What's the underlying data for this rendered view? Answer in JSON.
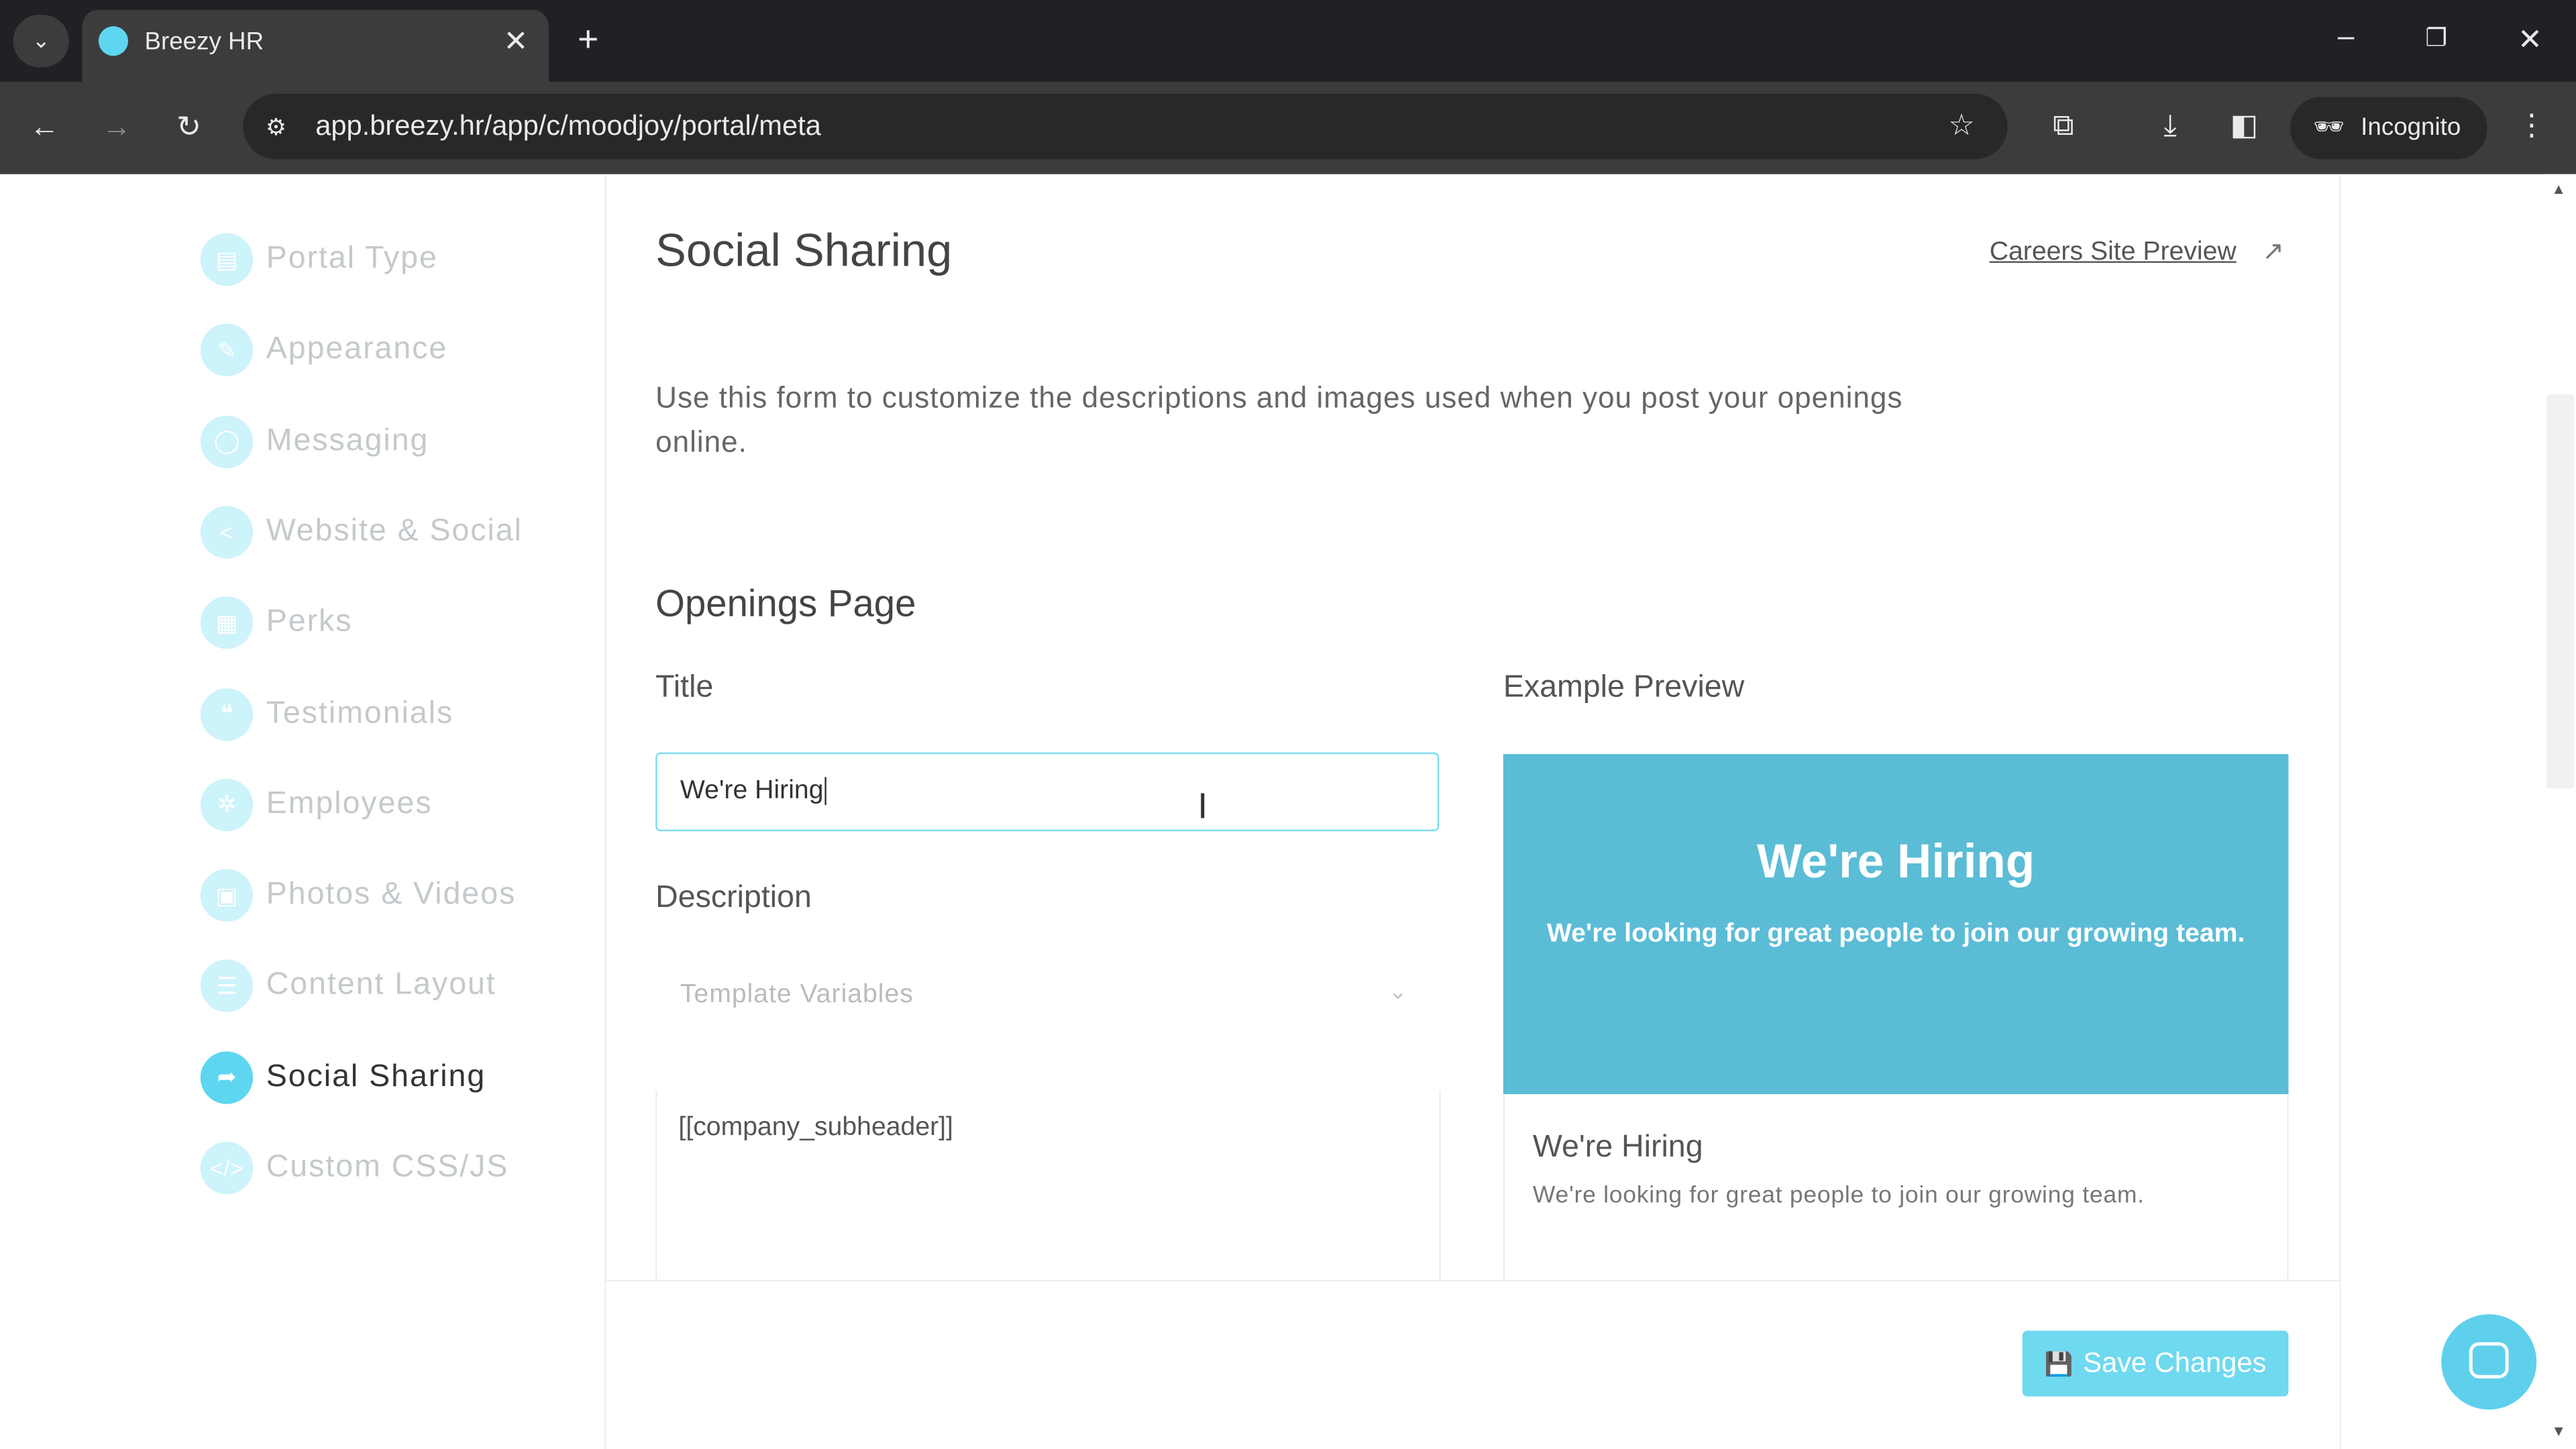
{
  "browser": {
    "tab_title": "Breezy HR",
    "url": "app.breezy.hr/app/c/moodjoy/portal/meta",
    "incognito_label": "Incognito"
  },
  "sidebar": {
    "items": [
      {
        "label": "Portal Type",
        "icon": "grid-icon"
      },
      {
        "label": "Appearance",
        "icon": "brush-icon"
      },
      {
        "label": "Messaging",
        "icon": "chat-bubble-icon"
      },
      {
        "label": "Website & Social",
        "icon": "share-icon"
      },
      {
        "label": "Perks",
        "icon": "gift-icon"
      },
      {
        "label": "Testimonials",
        "icon": "quotes-icon"
      },
      {
        "label": "Employees",
        "icon": "people-icon"
      },
      {
        "label": "Photos & Videos",
        "icon": "image-icon"
      },
      {
        "label": "Content Layout",
        "icon": "list-icon"
      },
      {
        "label": "Social Sharing",
        "icon": "share-arrow-icon",
        "active": true
      },
      {
        "label": "Custom CSS/JS",
        "icon": "code-icon"
      }
    ]
  },
  "main": {
    "title": "Social Sharing",
    "preview_link": "Careers Site Preview",
    "intro": "Use this form to customize the descriptions and images used when you post your openings online.",
    "section_title": "Openings Page",
    "title_label": "Title",
    "title_value": "We're Hiring",
    "description_label": "Description",
    "template_variables": "Template Variables",
    "description_value": "[[company_subheader]]",
    "example_preview_label": "Example Preview",
    "preview": {
      "image_title": "We're Hiring",
      "image_subtitle": "We're looking for great people to join our growing team.",
      "card_title": "We're Hiring",
      "card_text": "We're looking for great people to join our growing team."
    },
    "save_label": "Save Changes"
  },
  "colors": {
    "accent": "#5fd6f0",
    "preview_bg": "#5bbcd6",
    "save_button": "#6fd9ef"
  }
}
